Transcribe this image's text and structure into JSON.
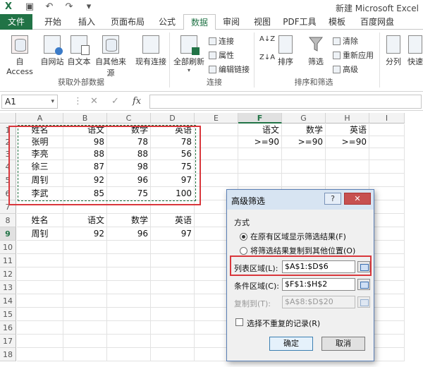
{
  "titlebar": {
    "title": "新建 Microsoft Excel"
  },
  "tabs": [
    "文件",
    "开始",
    "插入",
    "页面布局",
    "公式",
    "数据",
    "审阅",
    "视图",
    "PDF工具",
    "模板",
    "百度网盘"
  ],
  "ribbon": {
    "external": {
      "access": "自 Access",
      "web": "自网站",
      "text": "自文本",
      "other": "自其他来源",
      "existing": "现有连接",
      "group": "获取外部数据"
    },
    "connections": {
      "refresh": "全部刷新",
      "conn": "连接",
      "props": "属性",
      "edit": "编辑链接",
      "group": "连接"
    },
    "sort": {
      "az": "A↓Z",
      "za": "Z↓A",
      "sort": "排序",
      "filter": "筛选",
      "clear": "清除",
      "reapply": "重新应用",
      "advanced": "高级",
      "group": "排序和筛选"
    },
    "tools": {
      "split": "分列",
      "fast": "快速"
    }
  },
  "formula_bar": {
    "cell_ref": "A1",
    "fx": "fx"
  },
  "columns": [
    "A",
    "B",
    "C",
    "D",
    "E",
    "F",
    "G",
    "H",
    "I"
  ],
  "rows": [
    "1",
    "2",
    "3",
    "4",
    "5",
    "6",
    "7",
    "8",
    "9",
    "10",
    "11",
    "12",
    "13",
    "14",
    "15",
    "16",
    "17",
    "18"
  ],
  "sheet": {
    "headers": [
      "姓名",
      "语文",
      "数学",
      "英语"
    ],
    "data": [
      [
        "张明",
        "98",
        "78",
        "78"
      ],
      [
        "李亮",
        "88",
        "88",
        "56"
      ],
      [
        "徐三",
        "87",
        "98",
        "75"
      ],
      [
        "周钊",
        "92",
        "96",
        "97"
      ],
      [
        "李武",
        "85",
        "75",
        "100"
      ]
    ],
    "criteria_headers": [
      "语文",
      "数学",
      "英语"
    ],
    "criteria_values": [
      ">=90",
      ">=90",
      ">=90"
    ],
    "result_headers": [
      "姓名",
      "语文",
      "数学",
      "英语"
    ],
    "result_row": [
      "周钊",
      "92",
      "96",
      "97"
    ]
  },
  "dialog": {
    "title": "高级筛选",
    "help": "?",
    "close": "✕",
    "method_label": "方式",
    "option_in_place": "在原有区域显示筛选结果(F)",
    "option_copy": "将筛选结果复制到其他位置(O)",
    "list_range_label": "列表区域(L):",
    "list_range_value": "$A$1:$D$6",
    "criteria_range_label": "条件区域(C):",
    "criteria_range_value": "$F$1:$H$2",
    "copy_to_label": "复制到(T):",
    "copy_to_value": "$A$8:$D$20",
    "unique_label": "选择不重复的记录(R)",
    "ok": "确定",
    "cancel": "取消"
  },
  "colors": {
    "accent": "#217346",
    "highlight": "#d9373c"
  }
}
